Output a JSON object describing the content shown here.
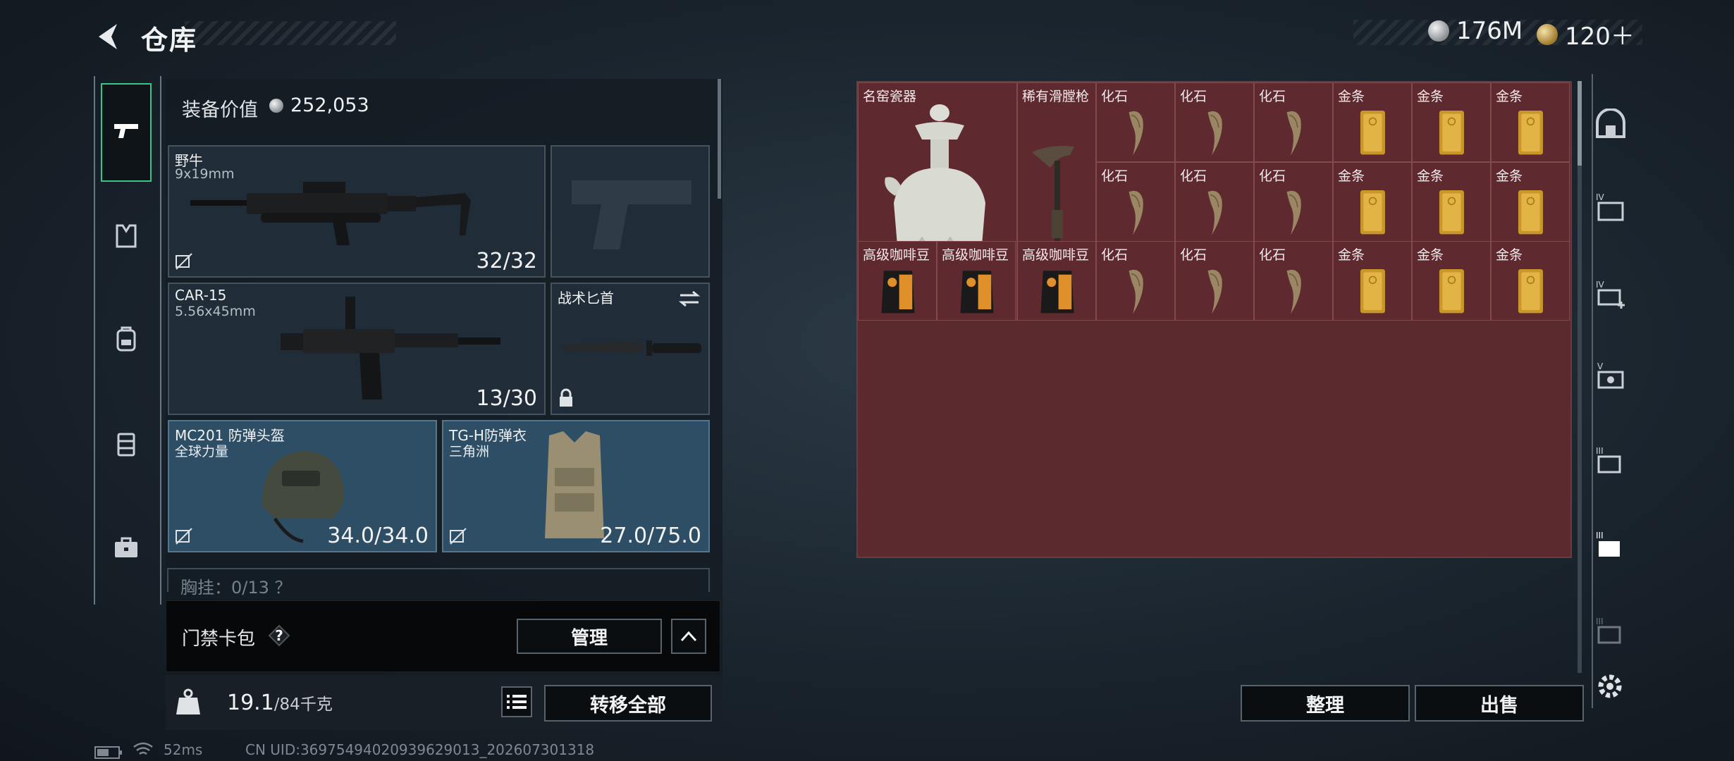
{
  "header": {
    "title": "仓库",
    "silver": "176M",
    "gold": "120＋"
  },
  "loadout": {
    "equip_label": "装备价值",
    "equip_value": "252,053",
    "slots": [
      {
        "name": "野牛",
        "sub": "9x19mm",
        "count": "32/32"
      },
      {
        "name": "CAR-15",
        "sub": "5.56x45mm",
        "count": "13/30"
      },
      {
        "name": "战术匕首"
      },
      {
        "name": "MC201 防弹头盔",
        "sub": "全球力量",
        "count": "34.0/34.0"
      },
      {
        "name": "TG-H防弹衣",
        "sub": "三角洲",
        "count": "27.0/75.0"
      }
    ],
    "chest_text": "胸挂：0/13 ？",
    "keycard_label": "门禁卡包",
    "keycard_help": "?",
    "manage_label": "管理",
    "weight_current": "19.1",
    "weight_max": "/84千克",
    "transfer_label": "转移全部"
  },
  "grid": {
    "items": [
      {
        "label": "名窑瓷器"
      },
      {
        "label": "稀有滑膛枪"
      },
      {
        "label": "化石"
      },
      {
        "label": "化石"
      },
      {
        "label": "化石"
      },
      {
        "label": "金条"
      },
      {
        "label": "金条"
      },
      {
        "label": "金条"
      },
      {
        "label": "化石"
      },
      {
        "label": "化石"
      },
      {
        "label": "化石"
      },
      {
        "label": "金条"
      },
      {
        "label": "金条"
      },
      {
        "label": "金条"
      },
      {
        "label": "高级咖啡豆"
      },
      {
        "label": "高级咖啡豆"
      },
      {
        "label": "高级咖啡豆"
      },
      {
        "label": "化石"
      },
      {
        "label": "化石"
      },
      {
        "label": "化石"
      },
      {
        "label": "金条"
      },
      {
        "label": "金条"
      },
      {
        "label": "金条"
      }
    ],
    "sort_label": "整理",
    "sell_label": "出售"
  },
  "status": {
    "ping": "52ms",
    "uid": "CN UID:36975494020939629013_202607301318"
  },
  "colors": {
    "accent_green": "#39c48a",
    "grid_bg": "#5a2a2e",
    "gear_slot": "#2e4e66"
  },
  "icons": [
    "back-arrow-icon",
    "pistol-icon",
    "vest-icon",
    "backpack-icon",
    "container-icon",
    "briefcase-icon",
    "safe-icon",
    "settings-icon"
  ]
}
